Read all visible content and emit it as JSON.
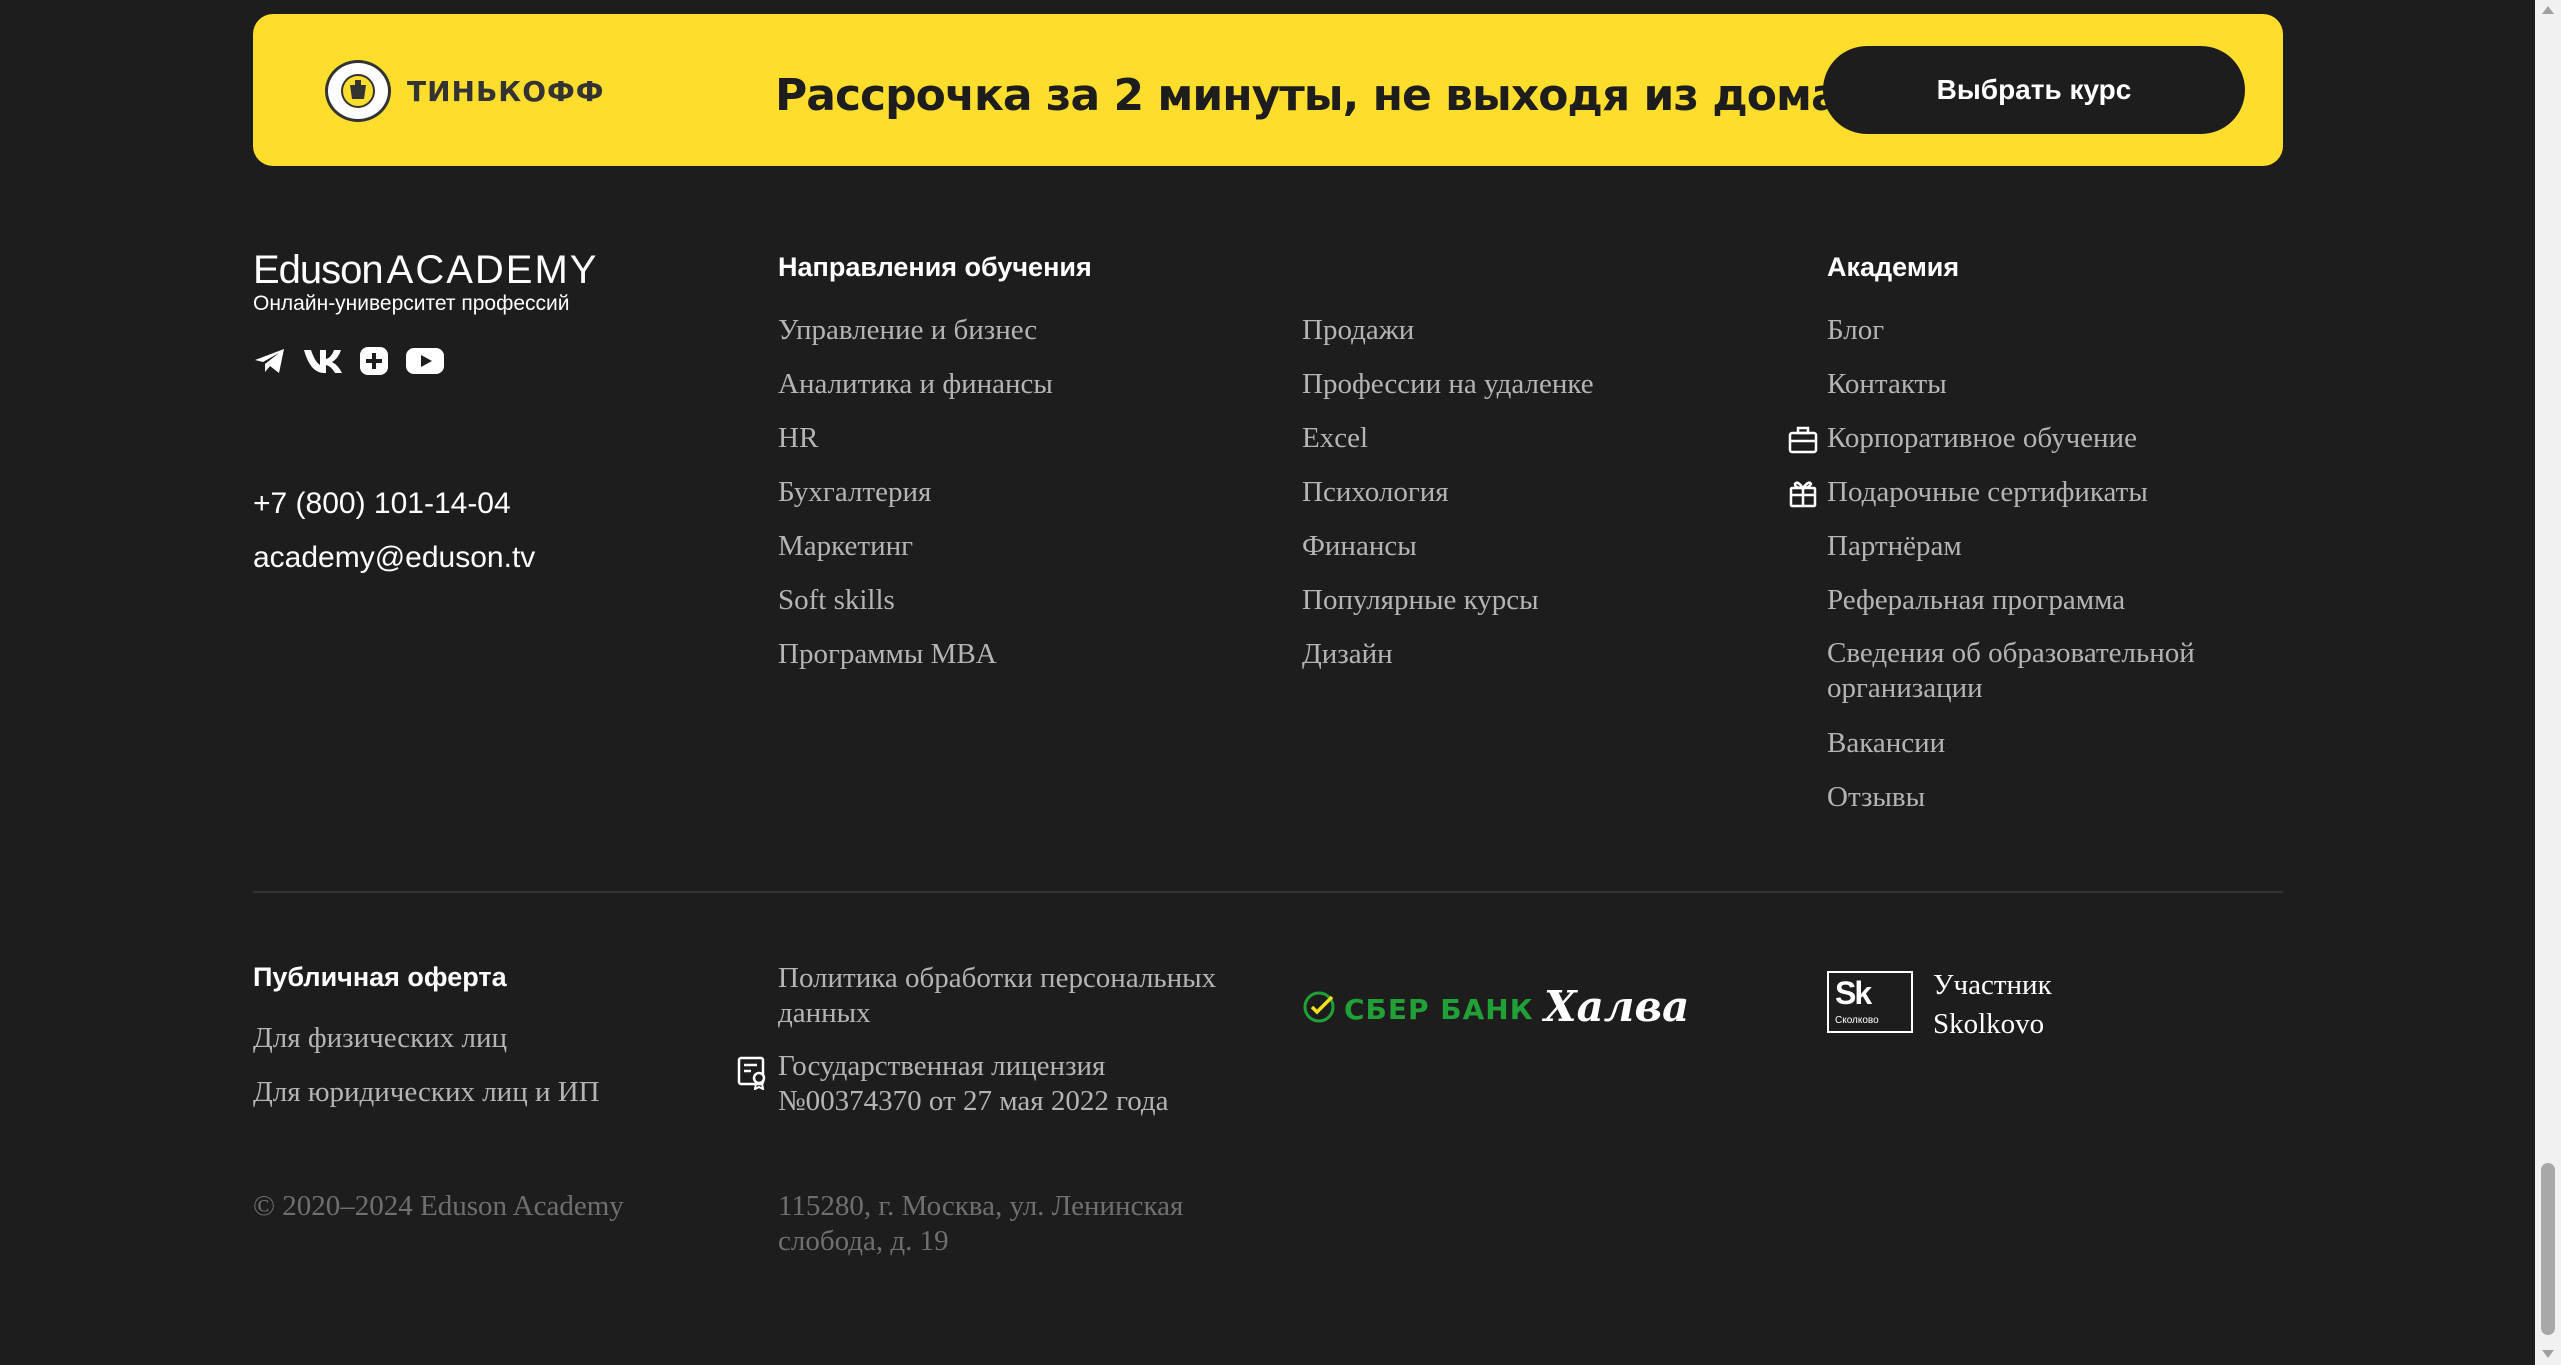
{
  "banner": {
    "brand": "ТИНЬКОФФ",
    "text": "Рассрочка за 2 минуты, не выходя из дома",
    "button": "Выбрать курс"
  },
  "brand": {
    "logo_main": "Eduson",
    "logo_accent": "ACADEMY",
    "subtitle": "Онлайн-университет профессий"
  },
  "social_icons": [
    "telegram-icon",
    "vk-icon",
    "plus-square-icon",
    "youtube-icon"
  ],
  "contacts": {
    "phone": "+7 (800) 101-14-04",
    "email": "academy@eduson.tv"
  },
  "directions": {
    "title": "Направления обучения",
    "col1": [
      "Управление и бизнес",
      "Аналитика и финансы",
      "HR",
      "Бухгалтерия",
      "Маркетинг",
      "Soft skills",
      "Программы MBA"
    ],
    "col2": [
      "Продажи",
      "Профессии на удаленке",
      "Excel",
      "Психология",
      "Финансы",
      "Популярные курсы",
      "Дизайн"
    ]
  },
  "academy": {
    "title": "Академия",
    "items": [
      "Блог",
      "Контакты",
      "Корпоративное обучение",
      "Подарочные сертификаты",
      "Партнёрам",
      "Реферальная программа",
      "Сведения об образовательной организации",
      "Вакансии",
      "Отзывы"
    ]
  },
  "offer": {
    "title": "Публичная оферта",
    "individuals": "Для физических лиц",
    "legal": "Для юридических лиц и ИП"
  },
  "policy": "Политика обработки персональных данных",
  "license": "Государственная лицензия №00374370 от 27 мая 2022 года",
  "partners": {
    "sber": "СБЕР БАНК",
    "halva": "Халва"
  },
  "skolkovo": {
    "badge": "Sk",
    "badge_small": "Сколково",
    "text": "Участник Skolkovo"
  },
  "copyright": "© 2020–2024 Eduson Academy",
  "address": "115280, г. Москва, ул. Ленинская слобода, д. 19",
  "colors": {
    "background": "#1e1d1d",
    "banner": "#ffdd2d",
    "link": "#b4b4b4",
    "muted": "#6f6f6f",
    "sber_green": "#21a038"
  }
}
